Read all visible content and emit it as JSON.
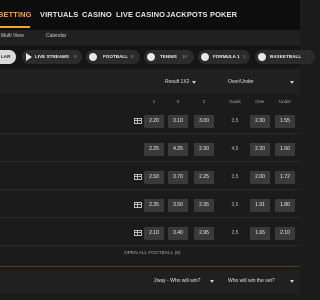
{
  "topnav": {
    "items": [
      "BETTING",
      "VIRTUALS",
      "CASINO",
      "LIVE CASINO",
      "JACKPOTS",
      "POKER"
    ],
    "active": "BETTING"
  },
  "subnav": {
    "items": [
      "Multi View",
      "Calendar"
    ]
  },
  "chips": [
    {
      "label": "LAR",
      "count": ""
    },
    {
      "label": "LIVE STREAMS",
      "count": "8",
      "icon": "play-icon"
    },
    {
      "label": "FOOTBALL",
      "count": "8",
      "icon": "football-icon"
    },
    {
      "label": "TENNIS",
      "count": "10",
      "icon": "tennis-icon"
    },
    {
      "label": "FORMULA 1",
      "count": "1",
      "icon": "formula1-icon"
    },
    {
      "label": "BASKETBALL",
      "count": "",
      "icon": "basketball-icon"
    }
  ],
  "market_header_1": {
    "left": "Result 1X2",
    "right": "Over/Under"
  },
  "column_headers": [
    "1",
    "X",
    "2",
    "Goals",
    "Over",
    "Under"
  ],
  "rows": [
    {
      "stats": true,
      "home": "2.20",
      "draw": "3.10",
      "away": "3.00",
      "goals": "3,5",
      "over": "2.30",
      "under": "1.55"
    },
    {
      "stats": false,
      "home": "2.25",
      "draw": "4.25",
      "away": "2.30",
      "goals": "4,5",
      "over": "2.20",
      "under": "1.60"
    },
    {
      "stats": true,
      "home": "2.50",
      "draw": "3.70",
      "away": "2.25",
      "goals": "3,5",
      "over": "2.00",
      "under": "1.72"
    },
    {
      "stats": true,
      "home": "2.35",
      "draw": "3.50",
      "away": "2.35",
      "goals": "3,5",
      "over": "1.91",
      "under": "1.80"
    },
    {
      "stats": true,
      "home": "2.10",
      "draw": "3.40",
      "away": "2.95",
      "goals": "2,5",
      "over": "1.65",
      "under": "2.10"
    }
  ],
  "open_all": "OPEN ALL FOOTBALL (8)",
  "market_header_2": {
    "left": "2way - Who will win?",
    "right": "Who will win the set?"
  },
  "colors": {
    "accent": "#f5a623",
    "background": "#1b1b1b",
    "odd_button": "#3a3a3a"
  }
}
